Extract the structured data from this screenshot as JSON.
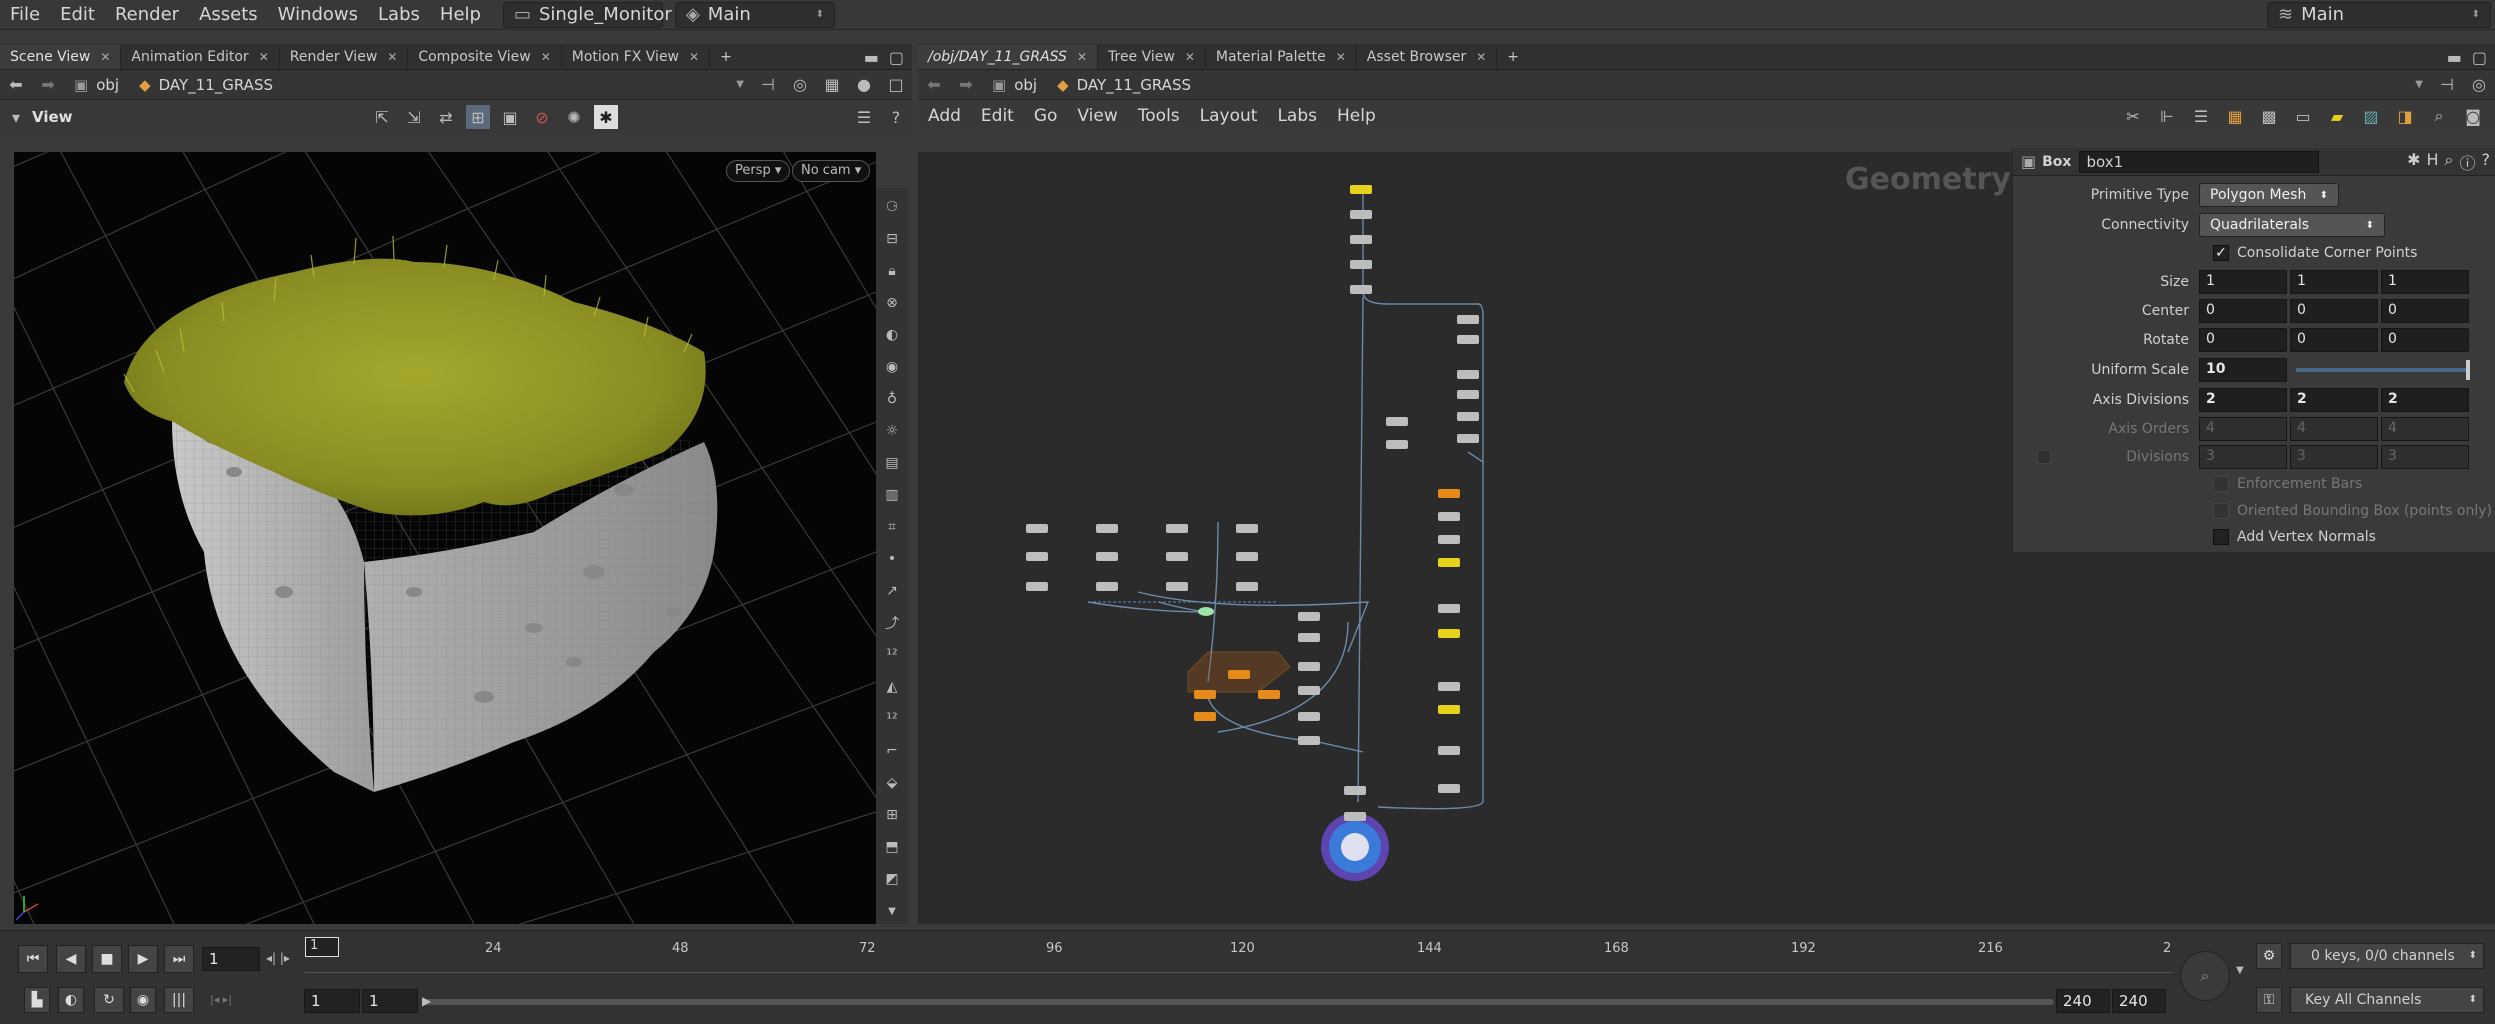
{
  "menubar": {
    "items": [
      "File",
      "Edit",
      "Render",
      "Assets",
      "Windows",
      "Labs",
      "Help"
    ],
    "desktop": "Single_Monitor",
    "context": "Main",
    "right_context": "Main"
  },
  "left_pane": {
    "tabs": [
      "Scene View",
      "Animation Editor",
      "Render View",
      "Composite View",
      "Motion FX View"
    ],
    "path": [
      "obj",
      "DAY_11_GRASS"
    ],
    "toolbar_title": "View",
    "persp_label": "Persp",
    "cam_label": "No cam"
  },
  "right_pane": {
    "tabs": [
      "/obj/DAY_11_GRASS",
      "Tree View",
      "Material Palette",
      "Asset Browser"
    ],
    "path": [
      "obj",
      "DAY_11_GRASS"
    ],
    "menu": [
      "Add",
      "Edit",
      "Go",
      "View",
      "Tools",
      "Layout",
      "Labs",
      "Help"
    ],
    "context_watermark": "Geometry"
  },
  "params": {
    "node_type": "Box",
    "node_name": "box1",
    "primitive_type_label": "Primitive Type",
    "primitive_type_value": "Polygon Mesh",
    "connectivity_label": "Connectivity",
    "connectivity_value": "Quadrilaterals",
    "consolidate_label": "Consolidate Corner Points",
    "size_label": "Size",
    "size": [
      "1",
      "1",
      "1"
    ],
    "center_label": "Center",
    "center": [
      "0",
      "0",
      "0"
    ],
    "rotate_label": "Rotate",
    "rotate": [
      "0",
      "0",
      "0"
    ],
    "uniform_scale_label": "Uniform Scale",
    "uniform_scale": "10",
    "axis_divisions_label": "Axis Divisions",
    "axis_divisions": [
      "2",
      "2",
      "2"
    ],
    "axis_orders_label": "Axis Orders",
    "axis_orders": [
      "4",
      "4",
      "4"
    ],
    "divisions_label": "Divisions",
    "divisions": [
      "3",
      "3",
      "3"
    ],
    "enforcement_bars_label": "Enforcement Bars",
    "oriented_bbox_label": "Oriented Bounding Box (points only)",
    "add_vertex_normals_label": "Add Vertex Normals"
  },
  "timeline": {
    "current_frame": "1",
    "frame_marker": "1",
    "ticks": [
      "24",
      "48",
      "72",
      "96",
      "120",
      "144",
      "168",
      "192",
      "216",
      "2"
    ],
    "start_frame": "1",
    "start_frame_2": "1",
    "end_frame": "240",
    "end_frame_2": "240",
    "keys_status": "0 keys, 0/0 channels",
    "key_mode": "Key All Channels"
  },
  "colors": {
    "node_default": "#bdbdbd",
    "node_display": "#e6d21c",
    "node_orange": "#e68a1a",
    "grass": "#9a9e2a"
  }
}
